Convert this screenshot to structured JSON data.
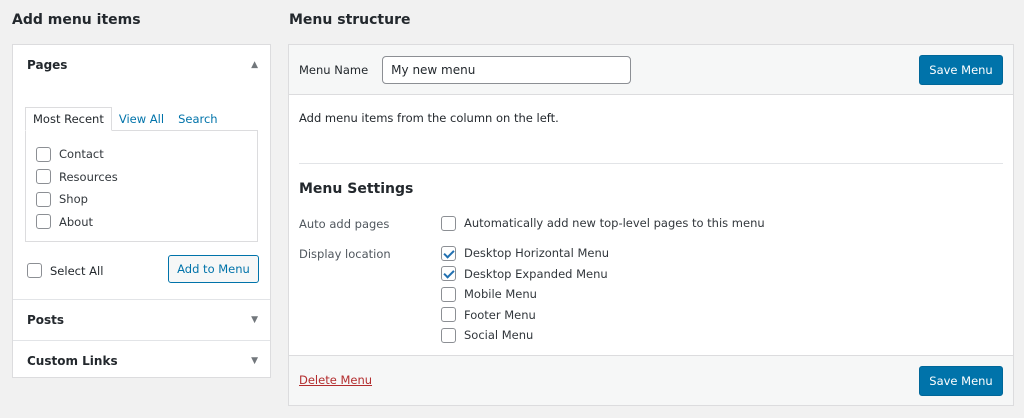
{
  "left": {
    "title": "Add menu items",
    "sections": {
      "pages": {
        "label": "Pages",
        "tabs": [
          "Most Recent",
          "View All",
          "Search"
        ],
        "items": [
          {
            "label": "Contact",
            "checked": false
          },
          {
            "label": "Resources",
            "checked": false
          },
          {
            "label": "Shop",
            "checked": false
          },
          {
            "label": "About",
            "checked": false
          }
        ],
        "select_all": "Select All",
        "add_button": "Add to Menu"
      },
      "posts": {
        "label": "Posts"
      },
      "custom_links": {
        "label": "Custom Links"
      }
    }
  },
  "right": {
    "title": "Menu structure",
    "menu_name_label": "Menu Name",
    "menu_name_value": "My new menu",
    "save_label": "Save Menu",
    "instructions": "Add menu items from the column on the left.",
    "settings": {
      "title": "Menu Settings",
      "auto_add_label": "Auto add pages",
      "auto_add_option": "Automatically add new top-level pages to this menu",
      "display_location_label": "Display location",
      "locations": [
        {
          "label": "Desktop Horizontal Menu",
          "checked": true
        },
        {
          "label": "Desktop Expanded Menu",
          "checked": true
        },
        {
          "label": "Mobile Menu",
          "checked": false
        },
        {
          "label": "Footer Menu",
          "checked": false
        },
        {
          "label": "Social Menu",
          "checked": false
        }
      ]
    },
    "delete_label": "Delete Menu"
  },
  "colors": {
    "accent": "#0073aa",
    "danger": "#b32d2e",
    "background": "#f1f1f1"
  }
}
